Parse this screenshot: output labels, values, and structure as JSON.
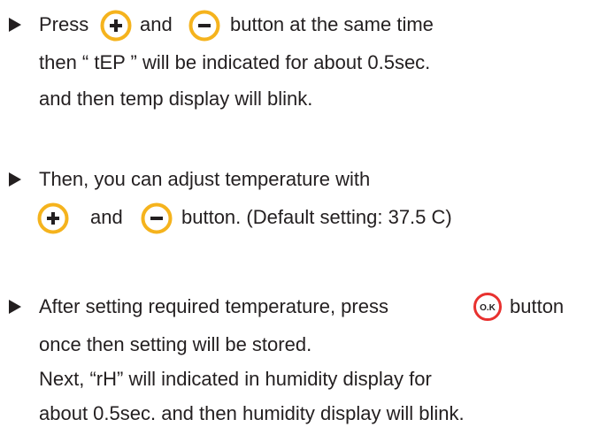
{
  "colors": {
    "text": "#231f20",
    "plus_minus_ring": "#f5b31d",
    "ok_ring": "#e8312f"
  },
  "icons": {
    "plus": "plus-circle-icon",
    "minus": "minus-circle-icon",
    "ok": "ok-circle-icon",
    "bullet": "triangle-bullet-icon"
  },
  "step1": {
    "w1": "Press",
    "w2": "and",
    "w3": "button at the same time",
    "l2": "then “ tEP ” will be indicated for about 0.5sec.",
    "l3": "and then temp display will blink."
  },
  "step2": {
    "l1": "Then, you can adjust temperature with",
    "w2": "and",
    "w3": "button. (Default setting: 37.5  C)"
  },
  "step3": {
    "w1": "After setting required temperature, press",
    "ok_label": "O.K",
    "w2": "button",
    "l2": "once then setting will be stored.",
    "l3": "Next, “rH” will indicated in humidity display for",
    "l4": "about 0.5sec. and then humidity display will blink."
  }
}
